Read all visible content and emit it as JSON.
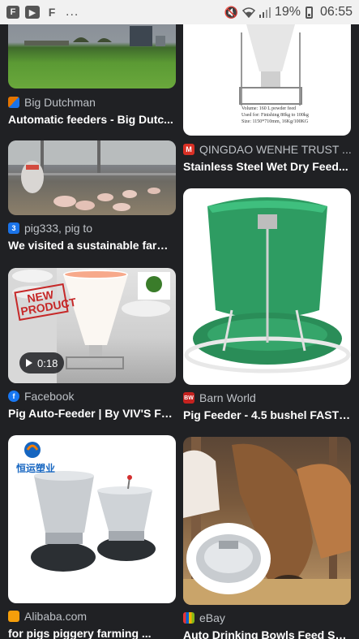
{
  "status_bar": {
    "overflow": "...",
    "battery_percent": "19%",
    "time": "06:55",
    "icons": [
      "flipboard-icon",
      "youtube-icon",
      "flipboard-alt-icon",
      "mute-icon",
      "wifi-icon",
      "signal-icon",
      "battery-icon"
    ]
  },
  "results": {
    "left": [
      {
        "source": "Big Dutchman",
        "title": "Automatic feeders - Big Dutc...",
        "favicon_color": "#e37400"
      },
      {
        "source": "pig333, pig to",
        "title": "We visited a sustainable farm...",
        "favicon_color": "#1a73e8",
        "favicon_text": "3"
      },
      {
        "source": "Facebook",
        "title": "Pig Auto-Feeder | By VIV'S Fa...",
        "favicon_color": "#1877f2",
        "favicon_text": "f",
        "video_duration": "0:18"
      },
      {
        "source": "Alibaba.com",
        "title": "for pigs piggery farming ...",
        "favicon_color": "#f59e0b"
      }
    ],
    "right": [
      {
        "source": "QINGDAO WENHE TRUST ...",
        "title": "Stainless Steel Wet Dry Feed...",
        "favicon_color": "#d93025",
        "favicon_text": "M",
        "image_text": [
          "Volume: 160 L  powder feed",
          "Used for: Finishing 80kg to 100kg",
          "Size: 1150*710mm, 16Kg/100KG"
        ]
      },
      {
        "source": "Barn World",
        "title": "Pig Feeder - 4.5 bushel FAST ...",
        "favicon_color": "#c5221f",
        "favicon_text": "BW"
      },
      {
        "source": "eBay",
        "title": "Auto Drinking Bowls Feed Su...",
        "favicon_color": "#0064d2"
      }
    ]
  },
  "image_overlays": {
    "new_product_stamp": "NEW PRODUCT",
    "chinese_logo": "恒运塑业"
  }
}
